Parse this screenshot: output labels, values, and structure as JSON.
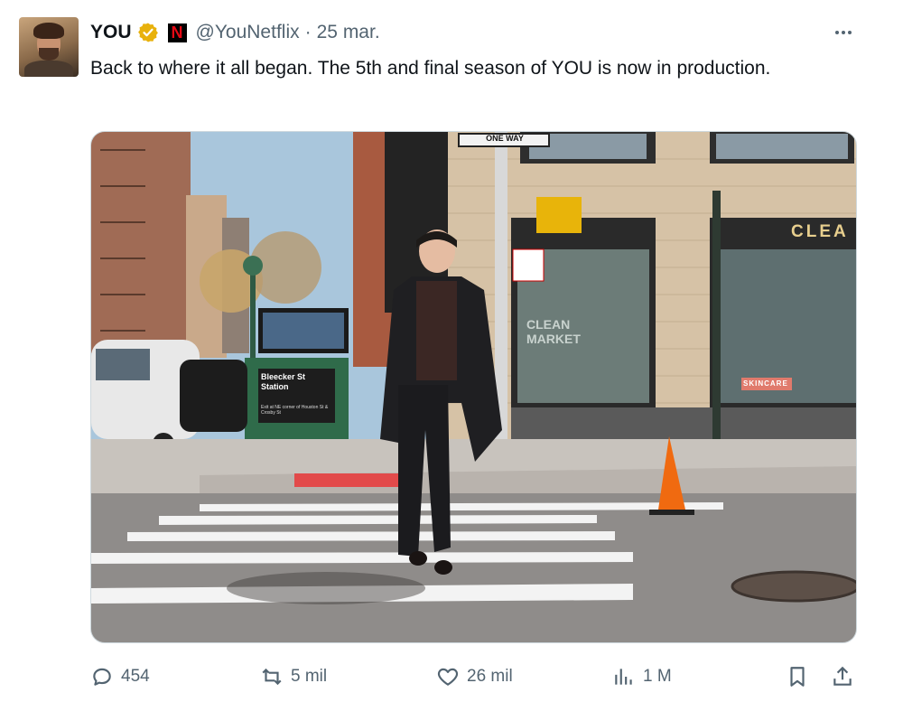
{
  "tweet": {
    "author_name": "YOU",
    "handle": "@YouNetflix",
    "separator": "·",
    "date": "25 mar.",
    "text": "Back to where it all began. The 5th and final season of YOU is now in production.",
    "brand_badge": "N"
  },
  "media_signs": {
    "one_way": "ONE WAY",
    "station_line1": "Bleecker St",
    "station_line2": "Station",
    "station_footer": "Exit at NE corner of Houston St & Crosby St",
    "store_sign": "CLEA",
    "window_text": "CLEAN MARKET",
    "skincare": "SKINCARE"
  },
  "actions": {
    "replies": "454",
    "reposts": "5 mil",
    "likes": "26 mil",
    "views": "1 M"
  },
  "colors": {
    "text_secondary": "#536471",
    "verified_gold": "#e8b10c",
    "netflix_red": "#e50914"
  }
}
